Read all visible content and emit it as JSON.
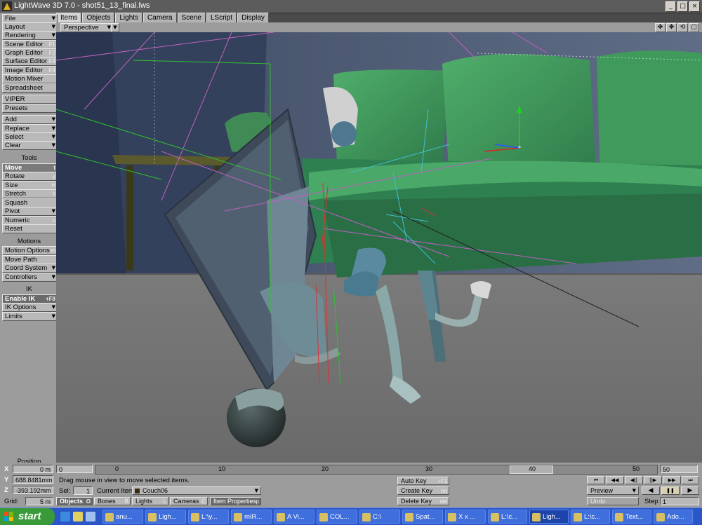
{
  "window": {
    "title": "LightWave 3D 7.0 - shot51_13_final.lws",
    "controls": [
      "_",
      "□",
      "×"
    ]
  },
  "tabs": [
    "Items",
    "Objects",
    "Lights",
    "Camera",
    "Scene",
    "LScript",
    "Display"
  ],
  "sidebar": {
    "file": "File",
    "layout": "Layout",
    "rendering": "Rendering",
    "scene_editor": "Scene Editor",
    "scene_editor_key": "F1",
    "graph_editor": "Graph Editor",
    "graph_editor_key": "F2",
    "surface_editor": "Surface Editor",
    "surface_editor_key": "F3",
    "image_editor": "Image Editor",
    "image_editor_key": "F4",
    "motion_mixer": "Motion Mixer",
    "spreadsheet": "Spreadsheet",
    "viper": "VIPER",
    "presets": "Presets",
    "add": "Add",
    "replace": "Replace",
    "select": "Select",
    "clear": "Clear",
    "tools_header": "Tools",
    "move": "Move",
    "move_key": "t",
    "rotate": "Rotate",
    "rotate_key": "y",
    "size": "Size",
    "size_key": "H",
    "stretch": "Stretch",
    "stretch_key": "h",
    "squash": "Squash",
    "pivot": "Pivot",
    "numeric": "Numeric",
    "numeric_key": "n",
    "reset": "Reset",
    "motions_header": "Motions",
    "motion_options": "Motion Options",
    "motion_options_key": "m",
    "move_path": "Move Path",
    "coord_system": "Coord System",
    "controllers": "Controllers",
    "ik_header": "IK",
    "enable_ik": "Enable IK",
    "enable_ik_key": "+F8",
    "ik_options": "IK Options",
    "limits": "Limits",
    "position_header": "Position"
  },
  "viewbar": {
    "view": "Perspective"
  },
  "coords": {
    "x_label": "X",
    "x": "0 m",
    "y_label": "Y",
    "y": "688.8481mm",
    "z_label": "Z",
    "z": "-393.192mm",
    "grid_label": "Grid:",
    "grid": "5 m"
  },
  "timeline": {
    "start": "0",
    "end": "50",
    "ticks": [
      "0",
      "10",
      "20",
      "30",
      "40",
      "50"
    ]
  },
  "status": "Drag mouse in view to move selected items.",
  "selection": {
    "sel_label": "Sel:",
    "sel": "1",
    "current_item_label": "Current Item",
    "current_item": "Couch06"
  },
  "modes": {
    "objects": "Objects",
    "objects_key": "O",
    "bones": "Bones",
    "bones_key": "B",
    "lights": "Lights",
    "lights_key": "L",
    "cameras": "Cameras",
    "cameras_key": "C",
    "item_properties": "Item Properties",
    "item_properties_key": "p"
  },
  "keys": {
    "auto_key": "Auto Key",
    "auto_key_key": "+F1",
    "create_key": "Create Key",
    "create_key_key": "ret",
    "delete_key": "Delete Key",
    "delete_key_key": "del"
  },
  "transport": {
    "first": "⏮",
    "prev_key": "◀◀",
    "prev_frame": "◀||",
    "next_frame": "||▶",
    "next_key": "▶▶",
    "last": "⏭",
    "preview": "Preview",
    "play_back": "◀",
    "pause": "❚❚",
    "play": "▶",
    "undo": "Undo",
    "step_label": "Step",
    "step": "1"
  },
  "taskbar": {
    "start": "start",
    "tasks": [
      {
        "label": "anu..."
      },
      {
        "label": "Ligh..."
      },
      {
        "label": "L:\\y..."
      },
      {
        "label": "mIR..."
      },
      {
        "label": "A Vi..."
      },
      {
        "label": "COL..."
      },
      {
        "label": "C:\\"
      },
      {
        "label": "Spat..."
      },
      {
        "label": "X x ..."
      },
      {
        "label": "L:\\c..."
      },
      {
        "label": "Ligh..."
      },
      {
        "label": "L:\\c..."
      },
      {
        "label": "Text..."
      },
      {
        "label": "Ado..."
      }
    ]
  }
}
